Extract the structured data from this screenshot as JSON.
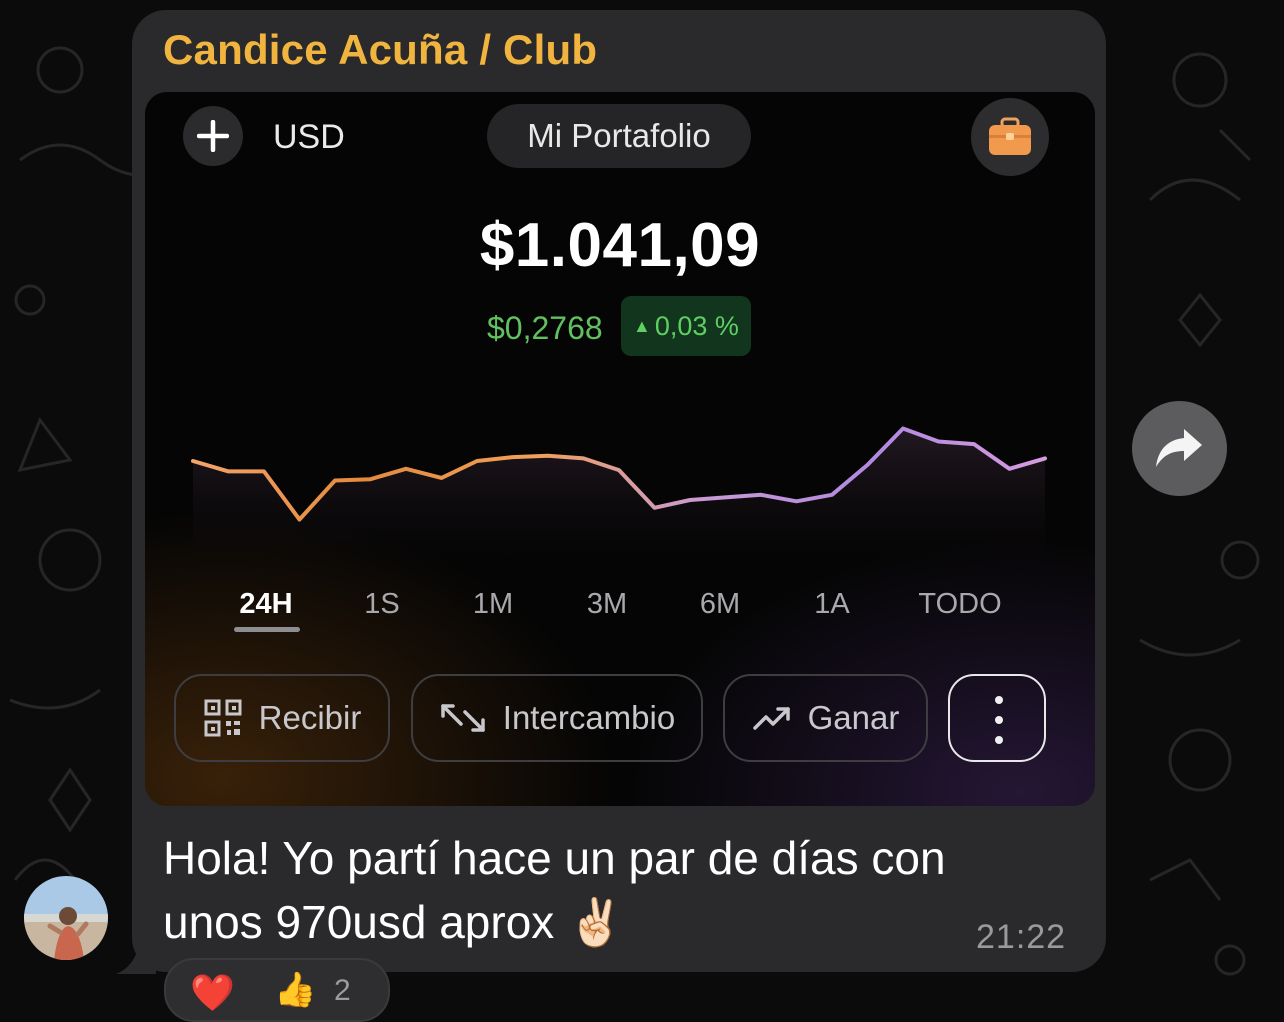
{
  "message": {
    "sender": "Candice Acuña / Club",
    "text_line1": "Hola! Yo partí hace un par de días con",
    "text_line2": "unos 970usd aprox",
    "emoji": "✌🏻",
    "time": "21:22",
    "reactions": {
      "heart": "❤️",
      "thumb": "👍",
      "count": "2"
    }
  },
  "screenshot": {
    "currency": "USD",
    "portfolio_label": "Mi Portafolio",
    "balance": "$1.041,09",
    "change_amount": "$0,2768",
    "change_percent": "0,03 %",
    "change_direction": "up",
    "ranges": [
      "24H",
      "1S",
      "1M",
      "3M",
      "6M",
      "1A",
      "TODO"
    ],
    "active_range": "24H",
    "actions": {
      "receive": "Recibir",
      "exchange": "Intercambio",
      "earn": "Ganar"
    },
    "icons": {
      "add": "plus-icon",
      "wallet": "briefcase-icon",
      "receive": "qr-code-icon",
      "exchange": "swap-arrows-icon",
      "earn": "trending-up-icon",
      "more": "vertical-dots-icon"
    }
  },
  "chart_data": {
    "type": "line",
    "title": "",
    "xlabel": "",
    "ylabel": "",
    "range": "24H",
    "series": [
      {
        "values": [
          0.7,
          0.62,
          0.62,
          0.25,
          0.55,
          0.56,
          0.64,
          0.57,
          0.7,
          0.73,
          0.74,
          0.72,
          0.63,
          0.34,
          0.4,
          0.42,
          0.44,
          0.39,
          0.44,
          0.67,
          0.95,
          0.85,
          0.83,
          0.64,
          0.72
        ]
      }
    ],
    "gradient_colors": [
      "#f3a46a",
      "#e38a3c",
      "#f0a05a",
      "#c99ad5",
      "#b089e0",
      "#d79ce0"
    ]
  },
  "colors": {
    "sender_name": "#f1b43e",
    "positive_change": "#61c15f",
    "bubble": "#2a2a2c"
  }
}
